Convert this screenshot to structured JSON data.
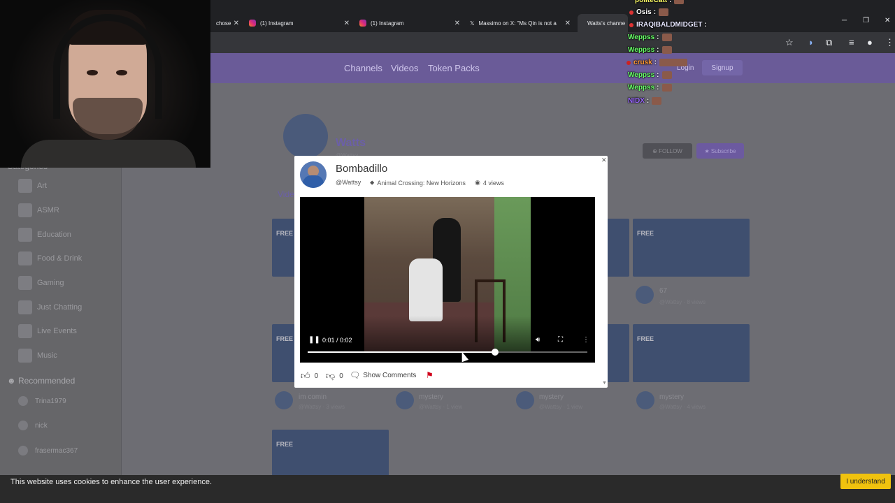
{
  "browser": {
    "tabs": [
      {
        "label": "chose",
        "icon": "generic-favicon"
      },
      {
        "label": "(1) Instagram",
        "icon": "instagram-icon"
      },
      {
        "label": "(1) Instagram",
        "icon": "instagram-icon"
      },
      {
        "label": "Massimo on X: \"Ms Qin is not a",
        "icon": "x-icon"
      },
      {
        "label": "Watts's channe",
        "icon": "site-favicon",
        "active": true
      }
    ]
  },
  "site": {
    "nav": [
      "Channels",
      "Videos",
      "Token Packs"
    ],
    "login": "Login",
    "signup": "Signup",
    "channel": {
      "name": "Watts",
      "handle": "@Wattsy",
      "follow": "FOLLOW",
      "subscribe": "Subscribe",
      "videos_tab": "Vide"
    },
    "categories_title": "Categories",
    "categories": [
      "Art",
      "ASMR",
      "Education",
      "Food & Drink",
      "Gaming",
      "Just Chatting",
      "Live Events",
      "Music"
    ],
    "recommended_title": "Recommended",
    "recommended": [
      "Trina1979",
      "nick",
      "frasermac367"
    ],
    "cards": [
      {
        "badge": "FREE",
        "title": "67",
        "sub": "@Wattsy · 8 views"
      },
      {
        "badge": "FREE",
        "title": "im comin",
        "sub": "@Wattsy · 3 views"
      },
      {
        "badge": "",
        "title": "mystery",
        "sub": "@Wattsy · 1 view"
      },
      {
        "badge": "",
        "title": "mystery",
        "sub": "@Wattsy · 1 view"
      },
      {
        "badge": "FREE",
        "title": "mystery",
        "sub": "@Wattsy · 4 views"
      }
    ],
    "free_badge": "FREE"
  },
  "modal": {
    "title": "Bombadillo",
    "handle": "@Wattsy",
    "game": "Animal Crossing: New Horizons",
    "views": "4 views",
    "time": "0:01 / 0:02",
    "progress": 0.67,
    "likes": "0",
    "dislikes": "0",
    "comments": "Show Comments",
    "report_color": "#d0021b"
  },
  "cookie": {
    "text": "This website uses cookies to enhance the user experience.",
    "button": "I understand"
  },
  "chat": [
    {
      "user": "politeCatt",
      "color": "#ffff66"
    },
    {
      "user": "Osis",
      "color": "#ffffff"
    },
    {
      "user": "IRAQIBALDMIDGET",
      "color": "#e6e6ff"
    },
    {
      "user": "Weppss",
      "color": "#66ff66"
    },
    {
      "user": "Weppss",
      "color": "#66ff66"
    },
    {
      "user": "crusk",
      "color": "#ff9933"
    },
    {
      "user": "Weppss",
      "color": "#66ff66"
    },
    {
      "user": "Weppss",
      "color": "#66ff66"
    },
    {
      "user": "NIDX",
      "color": "#9966ff"
    }
  ]
}
